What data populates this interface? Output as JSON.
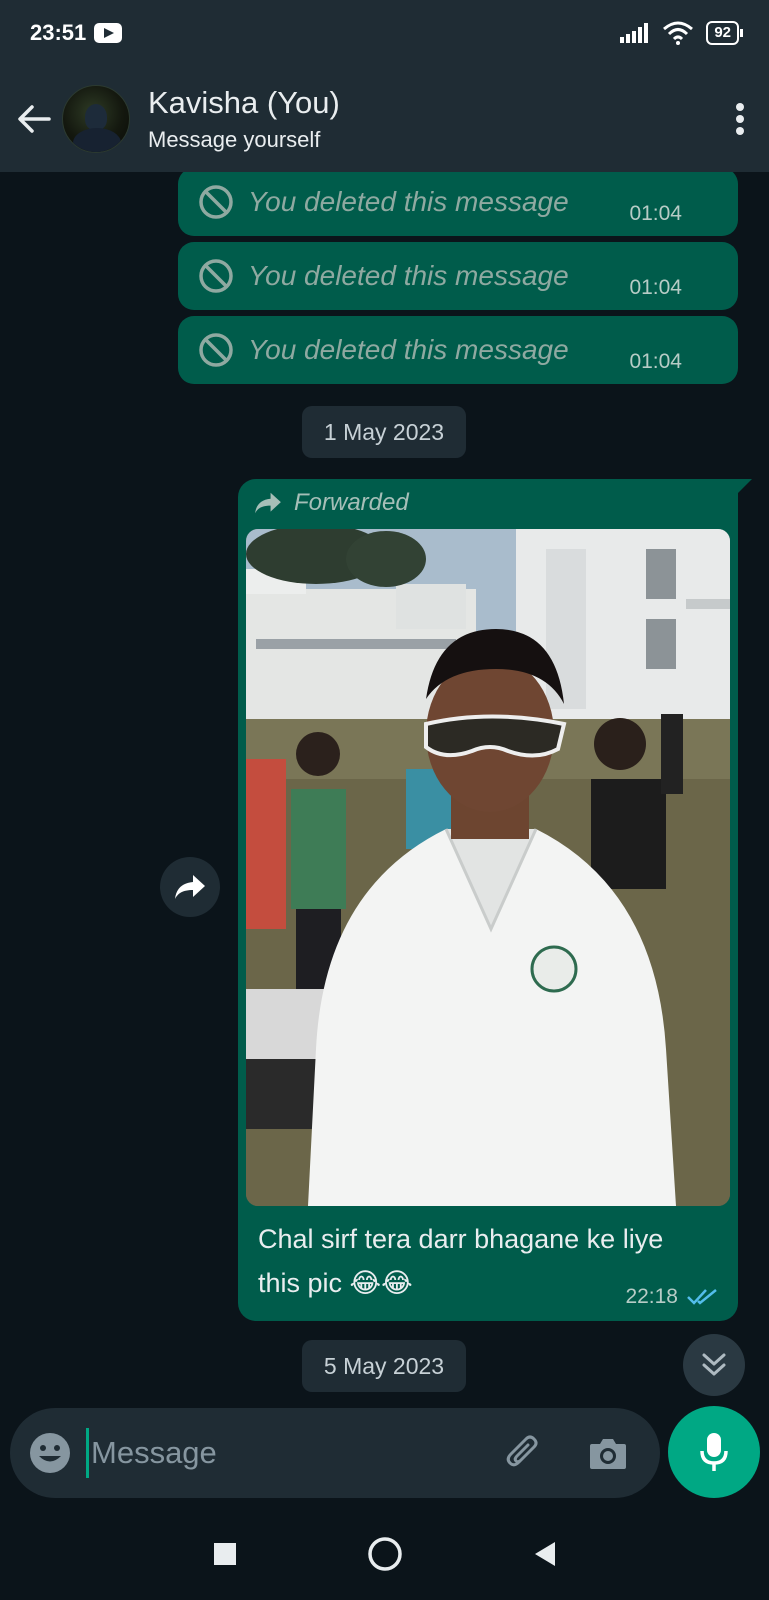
{
  "status_bar": {
    "time": "23:51",
    "battery": "92"
  },
  "header": {
    "name": "Kavisha (You)",
    "subtitle": "Message yourself"
  },
  "messages": {
    "deleted": [
      {
        "text": "You deleted this message",
        "time": "01:04"
      },
      {
        "text": "You deleted this message",
        "time": "01:04"
      },
      {
        "text": "You deleted this message",
        "time": "01:04"
      }
    ],
    "date_1": "1 May 2023",
    "forwarded_label": "Forwarded",
    "caption": "Chal sirf tera darr bhagane ke liye this pic 😂😂",
    "image_time": "22:18",
    "date_2": "5 May 2023"
  },
  "input": {
    "placeholder": "Message"
  },
  "colors": {
    "accent": "#00a884",
    "bubble_out": "#005c4b",
    "background": "#0b141a",
    "header": "#1f2c34"
  }
}
